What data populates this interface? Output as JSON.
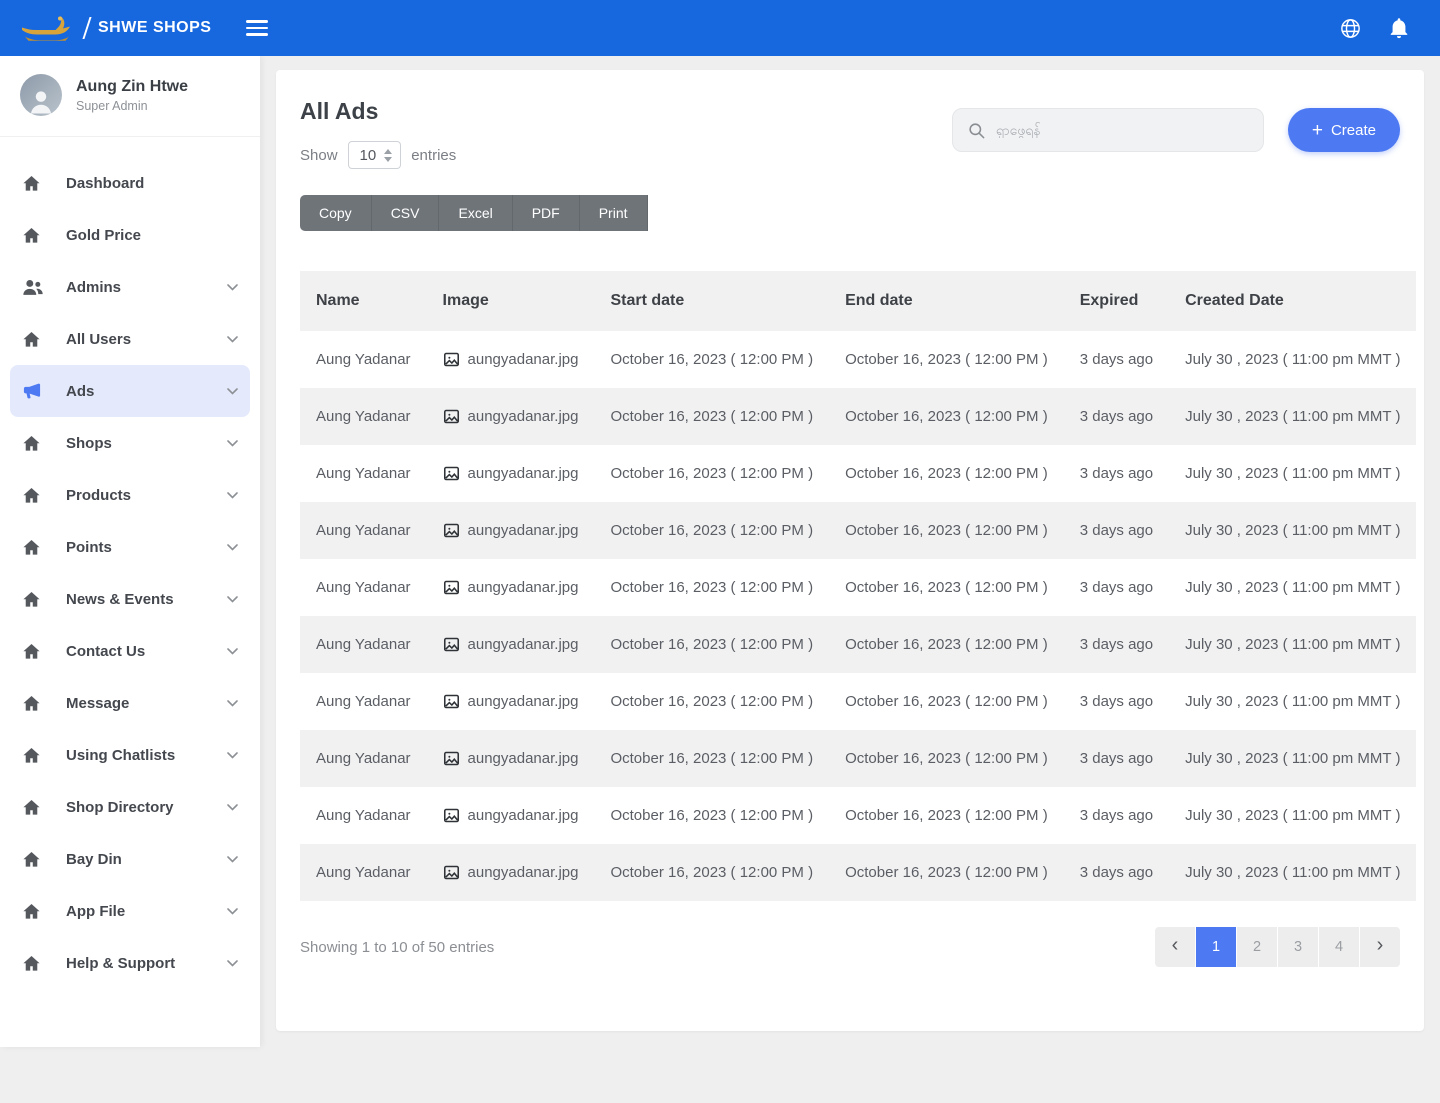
{
  "colors": {
    "topbar": "#1767df",
    "accent": "#4d79f2",
    "active-item-bg": "#e4eafc",
    "expired": "#e03a2f",
    "export-btn": "#6f7479",
    "gold": "#d7a43b"
  },
  "topbar": {
    "brand": "SHWE SHOPS"
  },
  "sidebar": {
    "user": {
      "name": "Aung Zin Htwe",
      "role": "Super Admin"
    },
    "items": [
      {
        "label": "Dashboard",
        "icon": "home",
        "expandable": false,
        "active": false
      },
      {
        "label": "Gold Price",
        "icon": "home",
        "expandable": false,
        "active": false
      },
      {
        "label": "Admins",
        "icon": "users",
        "expandable": true,
        "active": false
      },
      {
        "label": "All Users",
        "icon": "home",
        "expandable": true,
        "active": false
      },
      {
        "label": "Ads",
        "icon": "megaphone",
        "expandable": true,
        "active": true
      },
      {
        "label": "Shops",
        "icon": "home",
        "expandable": true,
        "active": false
      },
      {
        "label": "Products",
        "icon": "home",
        "expandable": true,
        "active": false
      },
      {
        "label": "Points",
        "icon": "home",
        "expandable": true,
        "active": false
      },
      {
        "label": "News & Events",
        "icon": "home",
        "expandable": true,
        "active": false
      },
      {
        "label": "Contact Us",
        "icon": "home",
        "expandable": true,
        "active": false
      },
      {
        "label": "Message",
        "icon": "home",
        "expandable": true,
        "active": false
      },
      {
        "label": "Using Chatlists",
        "icon": "home",
        "expandable": true,
        "active": false
      },
      {
        "label": "Shop Directory",
        "icon": "home",
        "expandable": true,
        "active": false
      },
      {
        "label": "Bay Din",
        "icon": "home",
        "expandable": true,
        "active": false
      },
      {
        "label": "App File",
        "icon": "home",
        "expandable": true,
        "active": false
      },
      {
        "label": "Help & Support",
        "icon": "home",
        "expandable": true,
        "active": false
      }
    ]
  },
  "main": {
    "title": "All Ads",
    "show_label": "Show",
    "page_length": "10",
    "entries_label": "entries",
    "search": {
      "placeholder": "ရှာဖွေရန်"
    },
    "create_button": {
      "plus": "+",
      "label": "Create"
    },
    "export_buttons": [
      "Copy",
      "CSV",
      "Excel",
      "PDF",
      "Print"
    ],
    "table": {
      "headers": [
        "Name",
        "Image",
        "Start date",
        "End date",
        "Expired",
        "Created Date"
      ],
      "rows": [
        {
          "name": "Aung Yadanar",
          "image": "aungyadanar.jpg",
          "start_date": "October 16, 2023 ( 12:00 PM )",
          "end_date": "October 16, 2023 ( 12:00 PM )",
          "expired": "3 days ago",
          "created_date": "July 30 , 2023 ( 11:00 pm MMT )"
        },
        {
          "name": "Aung Yadanar",
          "image": "aungyadanar.jpg",
          "start_date": "October 16, 2023 ( 12:00 PM )",
          "end_date": "October 16, 2023 ( 12:00 PM )",
          "expired": "3 days ago",
          "created_date": "July 30 , 2023 ( 11:00 pm MMT )"
        },
        {
          "name": "Aung Yadanar",
          "image": "aungyadanar.jpg",
          "start_date": "October 16, 2023 ( 12:00 PM )",
          "end_date": "October 16, 2023 ( 12:00 PM )",
          "expired": "3 days ago",
          "created_date": "July 30 , 2023 ( 11:00 pm MMT )"
        },
        {
          "name": "Aung Yadanar",
          "image": "aungyadanar.jpg",
          "start_date": "October 16, 2023 ( 12:00 PM )",
          "end_date": "October 16, 2023 ( 12:00 PM )",
          "expired": "3 days ago",
          "created_date": "July 30 , 2023 ( 11:00 pm MMT )"
        },
        {
          "name": "Aung Yadanar",
          "image": "aungyadanar.jpg",
          "start_date": "October 16, 2023 ( 12:00 PM )",
          "end_date": "October 16, 2023 ( 12:00 PM )",
          "expired": "3 days ago",
          "created_date": "July 30 , 2023 ( 11:00 pm MMT )"
        },
        {
          "name": "Aung Yadanar",
          "image": "aungyadanar.jpg",
          "start_date": "October 16, 2023 ( 12:00 PM )",
          "end_date": "October 16, 2023 ( 12:00 PM )",
          "expired": "3 days ago",
          "created_date": "July 30 , 2023 ( 11:00 pm MMT )"
        },
        {
          "name": "Aung Yadanar",
          "image": "aungyadanar.jpg",
          "start_date": "October 16, 2023 ( 12:00 PM )",
          "end_date": "October 16, 2023 ( 12:00 PM )",
          "expired": "3 days ago",
          "created_date": "July 30 , 2023 ( 11:00 pm MMT )"
        },
        {
          "name": "Aung Yadanar",
          "image": "aungyadanar.jpg",
          "start_date": "October 16, 2023 ( 12:00 PM )",
          "end_date": "October 16, 2023 ( 12:00 PM )",
          "expired": "3 days ago",
          "created_date": "July 30 , 2023 ( 11:00 pm MMT )"
        },
        {
          "name": "Aung Yadanar",
          "image": "aungyadanar.jpg",
          "start_date": "October 16, 2023 ( 12:00 PM )",
          "end_date": "October 16, 2023 ( 12:00 PM )",
          "expired": "3 days ago",
          "created_date": "July 30 , 2023 ( 11:00 pm MMT )"
        },
        {
          "name": "Aung Yadanar",
          "image": "aungyadanar.jpg",
          "start_date": "October 16, 2023 ( 12:00 PM )",
          "end_date": "October 16, 2023 ( 12:00 PM )",
          "expired": "3 days ago",
          "created_date": "July 30 , 2023 ( 11:00 pm MMT )"
        }
      ]
    },
    "footer": {
      "summary": "Showing 1 to 10 of 50 entries",
      "pagination": {
        "prev": "‹",
        "next": "›",
        "pages": [
          {
            "label": "1",
            "active": true
          },
          {
            "label": "2",
            "active": false
          },
          {
            "label": "3",
            "active": false
          },
          {
            "label": "4",
            "active": false
          }
        ]
      }
    }
  }
}
